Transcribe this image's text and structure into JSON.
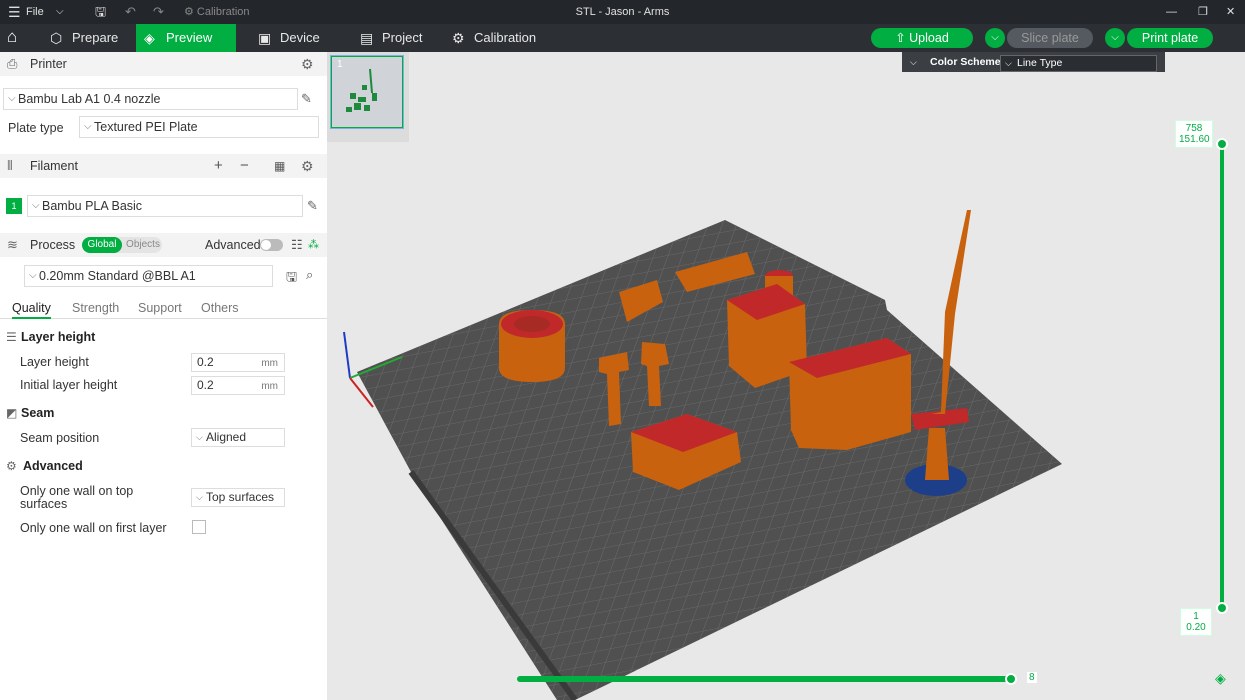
{
  "window": {
    "menu_label": "File",
    "calibration_label": "Calibration",
    "title": "STL - Jason - Arms"
  },
  "nav": {
    "tabs": [
      {
        "label": "Prepare",
        "icon": "cube-icon"
      },
      {
        "label": "Preview",
        "icon": "layers-icon"
      },
      {
        "label": "Device",
        "icon": "device-icon"
      },
      {
        "label": "Project",
        "icon": "project-icon"
      },
      {
        "label": "Calibration",
        "icon": "calibration-icon"
      }
    ],
    "active_tab": "Preview",
    "upload_label": "Upload",
    "slice_label": "Slice plate",
    "print_label": "Print plate"
  },
  "printer": {
    "section_label": "Printer",
    "printer_name": "Bambu Lab A1 0.4 nozzle",
    "plate_type_label": "Plate type",
    "plate_type_value": "Textured PEI Plate"
  },
  "filament": {
    "section_label": "Filament",
    "slot_number": "1",
    "slot_color": "#00ae42",
    "name": "Bambu PLA Basic"
  },
  "process": {
    "section_label": "Process",
    "toggle_global": "Global",
    "toggle_objects": "Objects",
    "advanced_label": "Advanced",
    "preset": "0.20mm Standard @BBL A1",
    "tabs": [
      "Quality",
      "Strength",
      "Support",
      "Others"
    ],
    "active_tab": "Quality"
  },
  "quality": {
    "layer_height_section": "Layer height",
    "layer_height_label": "Layer height",
    "layer_height_value": "0.2",
    "initial_layer_label": "Initial layer height",
    "initial_layer_value": "0.2",
    "unit": "mm",
    "seam_section": "Seam",
    "seam_position_label": "Seam position",
    "seam_position_value": "Aligned",
    "advanced_section": "Advanced",
    "one_wall_top_label": "Only one wall on top surfaces",
    "one_wall_top_value": "Top surfaces",
    "one_wall_first_label": "Only one wall on first layer"
  },
  "viewport": {
    "plate_index": "1",
    "color_scheme_label": "Color Scheme",
    "color_scheme_value": "Line Type",
    "layer_top_index": "758",
    "layer_top_height": "151.60",
    "layer_bottom_index": "1",
    "layer_bottom_height": "0.20",
    "horizontal_value": "8",
    "accent_color": "#00ae42",
    "model_color": "#c8620f",
    "top_surface_color": "#c0282a"
  }
}
